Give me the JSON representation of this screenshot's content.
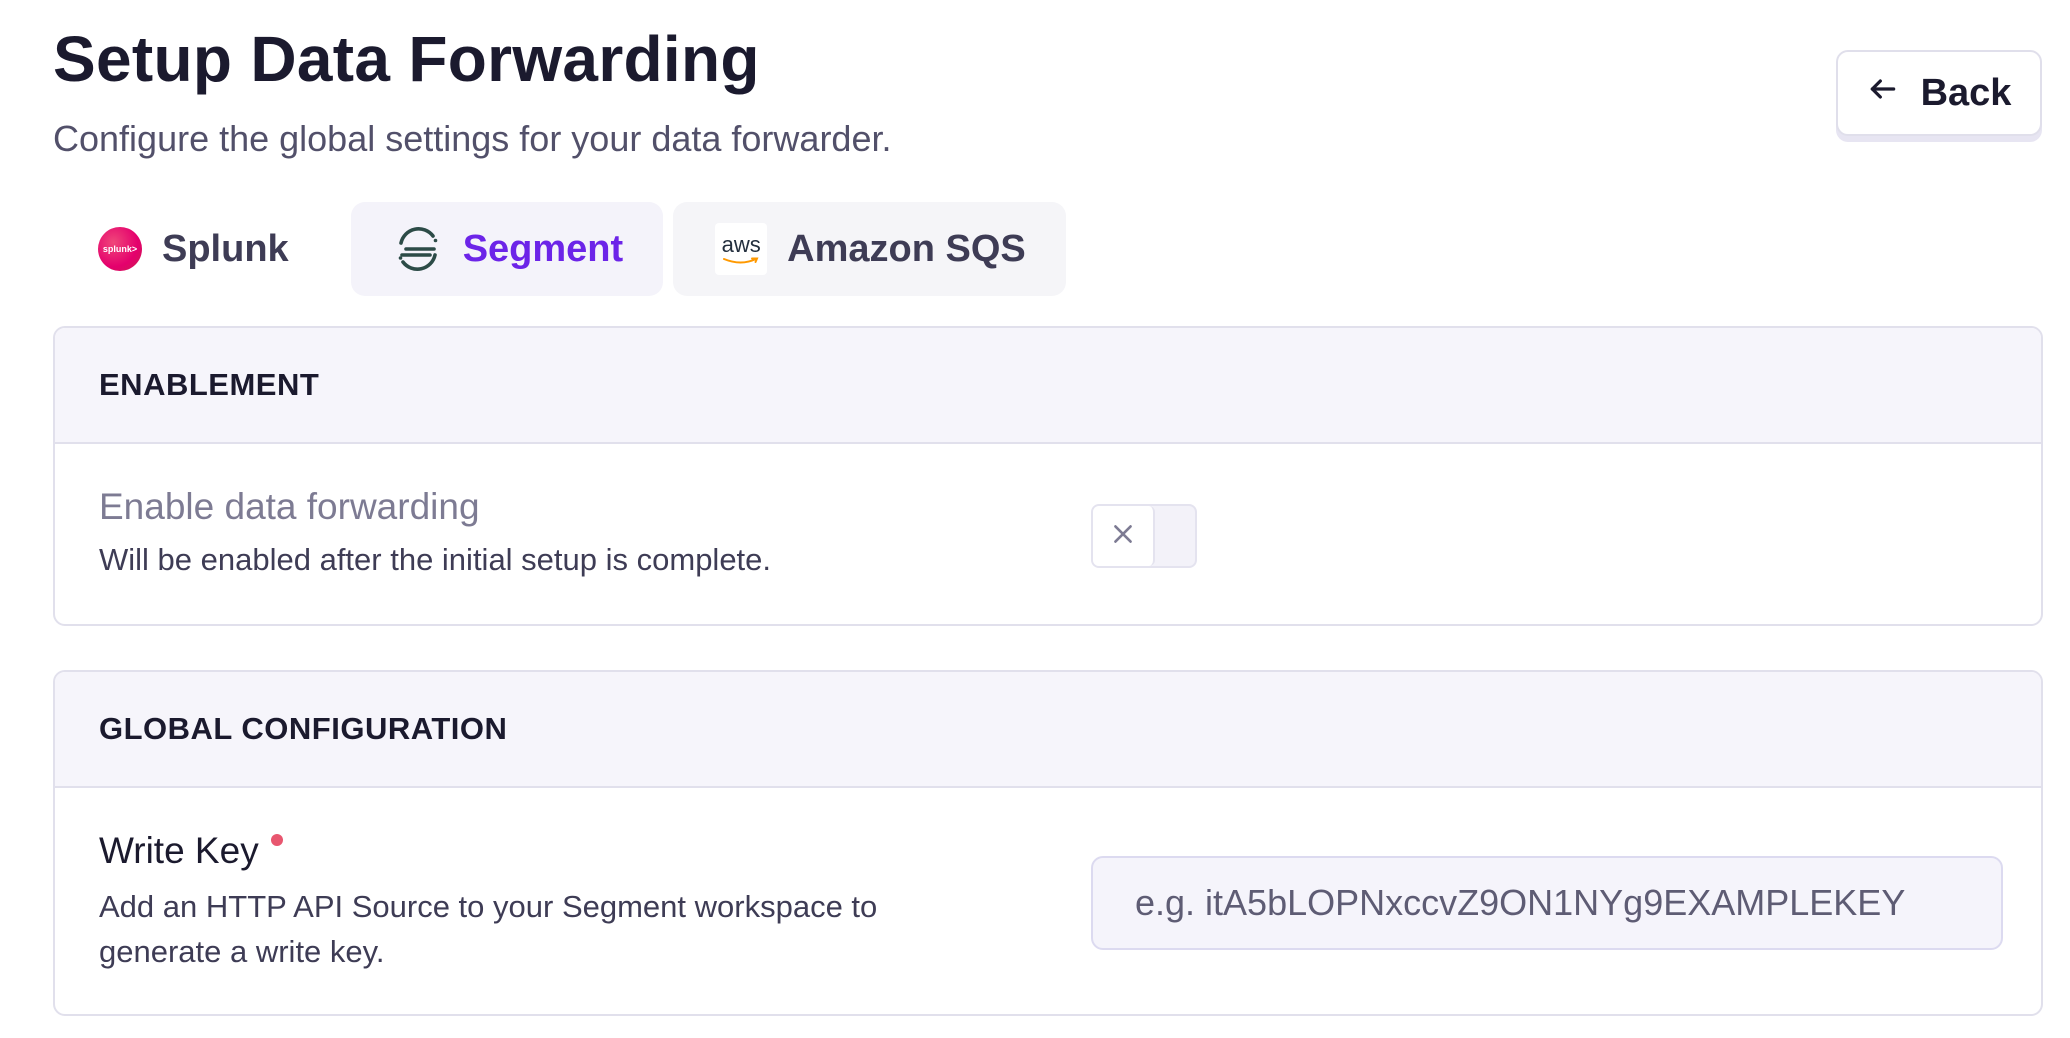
{
  "header": {
    "title": "Setup Data Forwarding",
    "subtitle": "Configure the global settings for your data forwarder.",
    "back_label": "Back"
  },
  "tabs": [
    {
      "label": "Splunk",
      "icon": "splunk-logo",
      "active": false
    },
    {
      "label": "Segment",
      "icon": "segment-logo",
      "active": true
    },
    {
      "label": "Amazon SQS",
      "icon": "aws-logo",
      "active": false
    }
  ],
  "icons": {
    "splunk_logo_text": "splunk>",
    "aws_logo_text": "aws"
  },
  "enablement": {
    "section_title": "ENABLEMENT",
    "label": "Enable data forwarding",
    "description": "Will be enabled after the initial setup is complete.",
    "enabled": false
  },
  "global_configuration": {
    "section_title": "GLOBAL CONFIGURATION",
    "write_key": {
      "label": "Write Key",
      "required": true,
      "description": "Add an HTTP API Source to your Segment workspace to generate a write key.",
      "value": "",
      "placeholder": "e.g. itA5bLOPNxccvZ9ON1NYg9EXAMPLEKEY"
    }
  },
  "colors": {
    "accent": "#6c24e8",
    "required": "#e8566f",
    "splunk_brand": "#e4006d",
    "aws_smile": "#ff9900"
  }
}
